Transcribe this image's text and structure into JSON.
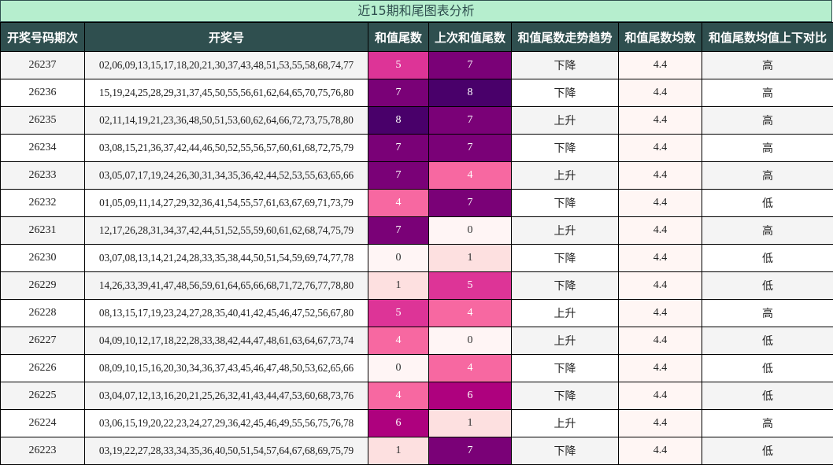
{
  "title": "近15期和尾图表分析",
  "headers": [
    "开奖号码期次",
    "开奖号",
    "和值尾数",
    "上次和值尾数",
    "和值尾数走势趋势",
    "和值尾数均数",
    "和值尾数均值上下对比"
  ],
  "heat_colors": {
    "0": {
      "bg": "#fff5f5",
      "fg": "#333333"
    },
    "1": {
      "bg": "#fde0e0",
      "fg": "#333333"
    },
    "4": {
      "bg": "#f768a1",
      "fg": "#ffffff"
    },
    "5": {
      "bg": "#dd3497",
      "fg": "#ffffff"
    },
    "6": {
      "bg": "#ae017e",
      "fg": "#ffffff"
    },
    "7": {
      "bg": "#7a0177",
      "fg": "#ffffff"
    },
    "8": {
      "bg": "#49006a",
      "fg": "#ffffff"
    }
  },
  "rows": [
    {
      "period": "26237",
      "numbers": "02,06,09,13,15,17,18,20,21,30,37,43,48,51,53,55,58,68,74,77",
      "tail": "5",
      "prev_tail": "7",
      "trend": "下降",
      "avg": "4.4",
      "compare": "高"
    },
    {
      "period": "26236",
      "numbers": "15,19,24,25,28,29,31,37,45,50,55,56,61,62,64,65,70,75,76,80",
      "tail": "7",
      "prev_tail": "8",
      "trend": "下降",
      "avg": "4.4",
      "compare": "高"
    },
    {
      "period": "26235",
      "numbers": "02,11,14,19,21,23,36,48,50,51,53,60,62,64,66,72,73,75,78,80",
      "tail": "8",
      "prev_tail": "7",
      "trend": "上升",
      "avg": "4.4",
      "compare": "高"
    },
    {
      "period": "26234",
      "numbers": "03,08,15,21,36,37,42,44,46,50,52,55,56,57,60,61,68,72,75,79",
      "tail": "7",
      "prev_tail": "7",
      "trend": "下降",
      "avg": "4.4",
      "compare": "高"
    },
    {
      "period": "26233",
      "numbers": "03,05,07,17,19,24,26,30,31,34,35,36,42,44,52,53,55,63,65,66",
      "tail": "7",
      "prev_tail": "4",
      "trend": "上升",
      "avg": "4.4",
      "compare": "高"
    },
    {
      "period": "26232",
      "numbers": "01,05,09,11,14,27,29,32,36,41,54,55,57,61,63,67,69,71,73,79",
      "tail": "4",
      "prev_tail": "7",
      "trend": "下降",
      "avg": "4.4",
      "compare": "低"
    },
    {
      "period": "26231",
      "numbers": "12,17,26,28,31,34,37,42,44,51,52,55,59,60,61,62,68,74,75,79",
      "tail": "7",
      "prev_tail": "0",
      "trend": "上升",
      "avg": "4.4",
      "compare": "高"
    },
    {
      "period": "26230",
      "numbers": "03,07,08,13,14,21,24,28,33,35,38,44,50,51,54,59,69,74,77,78",
      "tail": "0",
      "prev_tail": "1",
      "trend": "下降",
      "avg": "4.4",
      "compare": "低"
    },
    {
      "period": "26229",
      "numbers": "14,26,33,39,41,47,48,56,59,61,64,65,66,68,71,72,76,77,78,80",
      "tail": "1",
      "prev_tail": "5",
      "trend": "下降",
      "avg": "4.4",
      "compare": "低"
    },
    {
      "period": "26228",
      "numbers": "08,13,15,17,19,23,24,27,28,35,40,41,42,45,46,47,52,56,67,80",
      "tail": "5",
      "prev_tail": "4",
      "trend": "上升",
      "avg": "4.4",
      "compare": "高"
    },
    {
      "period": "26227",
      "numbers": "04,09,10,12,17,18,22,28,33,38,42,44,47,48,61,63,64,67,73,74",
      "tail": "4",
      "prev_tail": "0",
      "trend": "上升",
      "avg": "4.4",
      "compare": "低"
    },
    {
      "period": "26226",
      "numbers": "08,09,10,15,16,20,30,34,36,37,43,45,46,47,48,50,53,62,65,66",
      "tail": "0",
      "prev_tail": "4",
      "trend": "下降",
      "avg": "4.4",
      "compare": "低"
    },
    {
      "period": "26225",
      "numbers": "03,04,07,12,13,16,20,21,25,26,32,41,43,44,47,53,60,68,73,76",
      "tail": "4",
      "prev_tail": "6",
      "trend": "下降",
      "avg": "4.4",
      "compare": "低"
    },
    {
      "period": "26224",
      "numbers": "03,06,15,19,20,22,23,24,27,29,36,42,45,46,49,55,56,75,76,78",
      "tail": "6",
      "prev_tail": "1",
      "trend": "上升",
      "avg": "4.4",
      "compare": "高"
    },
    {
      "period": "26223",
      "numbers": "03,19,22,27,28,33,34,35,36,40,50,51,54,57,64,67,68,69,75,79",
      "tail": "1",
      "prev_tail": "7",
      "trend": "下降",
      "avg": "4.4",
      "compare": "低"
    }
  ]
}
